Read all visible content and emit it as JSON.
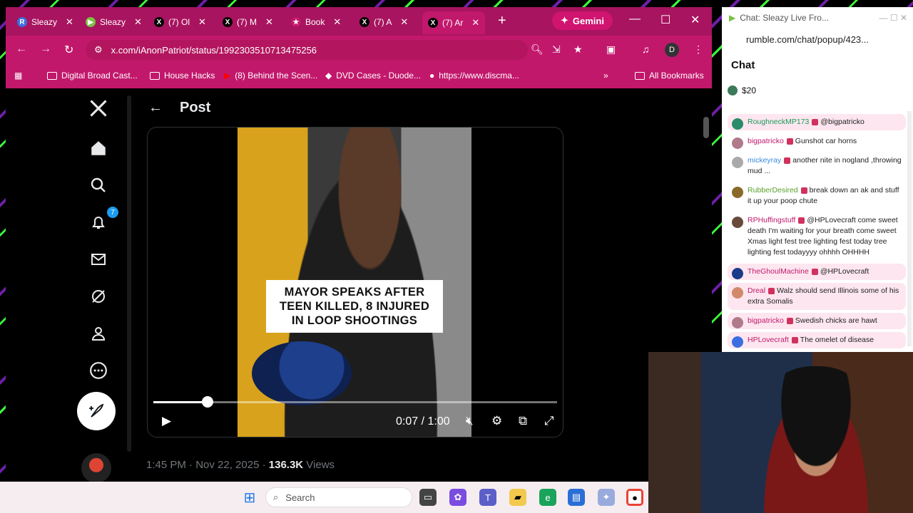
{
  "browser": {
    "tabs": [
      {
        "label": "Sleazy",
        "fav": "R",
        "fav_color": "#3b6ee0"
      },
      {
        "label": "Sleazy",
        "fav": "▶",
        "fav_color": "#7bc142"
      },
      {
        "label": "(7) Ol",
        "fav": "X",
        "fav_color": "#000000"
      },
      {
        "label": "(7) M",
        "fav": "X",
        "fav_color": "#000000"
      },
      {
        "label": "Book",
        "fav": "★",
        "fav_color": "#c2186c"
      },
      {
        "label": "(7) A",
        "fav": "X",
        "fav_color": "#000000"
      },
      {
        "label": "(7) Ar",
        "fav": "X",
        "fav_color": "#000000"
      }
    ],
    "new_tab": "+",
    "gemini_label": "Gemini",
    "url": "x.com/iAnonPatriot/status/1992303510713475256",
    "profile_initial": "D",
    "bookmarks": [
      "Digital Broad Cast...",
      "House Hacks",
      "(8) Behind the Scen...",
      "DVD Cases - Duode...",
      "https://www.discma..."
    ],
    "all_bookmarks": "All Bookmarks"
  },
  "x": {
    "page_title": "Post",
    "notification_count": "7",
    "video_caption_lines": [
      "MAYOR SPEAKS AFTER",
      "TEEN KILLED, 8 INJURED",
      "IN LOOP SHOOTINGS"
    ],
    "time_display": "0:07 / 1:00",
    "progress_fraction": 0.135,
    "post_time": "1:45 PM · Nov 22, 2025 · ",
    "views_count": "136.3K",
    "views_label": " Views"
  },
  "chat": {
    "window_title": "Chat: Sleazy Live Fro...",
    "url": "rumble.com/chat/popup/423...",
    "heading": "Chat",
    "rant_amount": "$20",
    "messages": [
      {
        "user": "RoughneckMP173",
        "text": "@bigpatricko",
        "user_color": "#1a9a5a",
        "hl": true,
        "av": "#2a8a6a"
      },
      {
        "user": "bigpatricko",
        "text": "Gunshot car horns",
        "user_color": "#c2186c",
        "hl": false,
        "av": "#b07a8a"
      },
      {
        "user": "mickeyray",
        "text": "another nite in nogland ,throwing mud ...",
        "user_color": "#3b8ad9",
        "hl": false,
        "av": "#aaaaaa"
      },
      {
        "user": "RubberDesired",
        "text": "break down an ak and stuff it up your poop chute",
        "user_color": "#5aa02c",
        "hl": false,
        "av": "#8a6a2a"
      },
      {
        "user": "RPHuffingstuff",
        "text": "@HPLovecraft come sweet death I'm waiting for your breath come sweet Xmas light fest tree lighting fest today tree lighting fest todayyyy ohhhh OHHHH",
        "user_color": "#c2186c",
        "hl": false,
        "av": "#6a4a3a"
      },
      {
        "user": "TheGhoulMachine",
        "text": "@HPLovecraft",
        "user_color": "#c2186c",
        "hl": true,
        "av": "#1a3a8a"
      },
      {
        "user": "Dreal",
        "text": "Walz should send Illinois some of his extra Somalis",
        "user_color": "#c2186c",
        "hl": true,
        "av": "#d08a6a"
      },
      {
        "user": "bigpatricko",
        "text": "Swedish chicks are hawt",
        "user_color": "#c2186c",
        "hl": true,
        "av": "#b07a8a"
      },
      {
        "user": "HPLovecraft",
        "text": "The omelet of disease",
        "user_color": "#c2186c",
        "hl": true,
        "av": "#3b6ee0"
      }
    ]
  },
  "taskbar": {
    "search_placeholder": "Search"
  },
  "colors": {
    "tab_bar": "#a8145f",
    "toolbar": "#c2186c",
    "x_blue": "#1d9bf0"
  }
}
